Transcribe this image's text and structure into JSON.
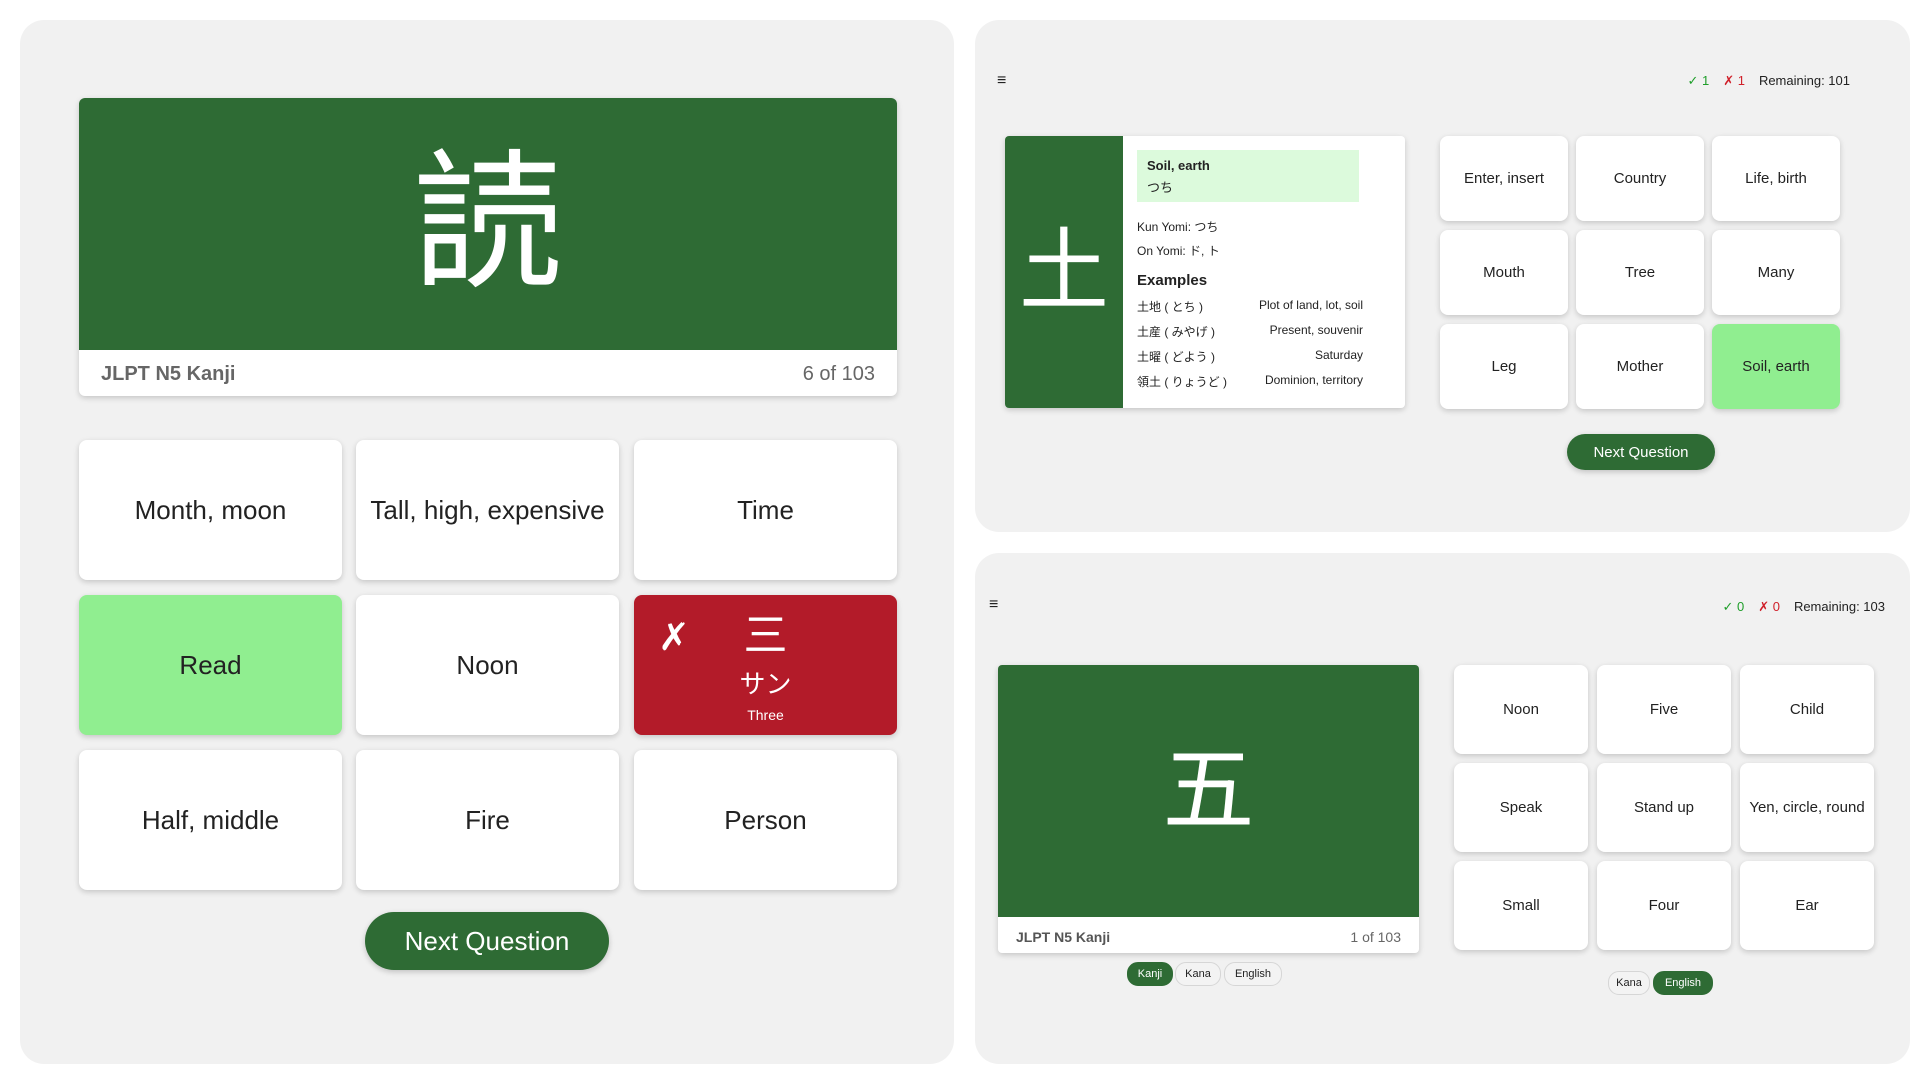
{
  "left": {
    "kanji": "読",
    "deck_title": "JLPT N5 Kanji",
    "progress": "6 of 103",
    "options": [
      "Month, moon",
      "Tall, high, expensive",
      "Time",
      "Read",
      "Noon",
      "",
      "Half, middle",
      "Fire",
      "Person"
    ],
    "wrong_option": {
      "mark": "✗",
      "kanji": "三",
      "kana": "サン",
      "meaning": "Three"
    },
    "next_label": "Next Question"
  },
  "top_right": {
    "menu_icon": "≡",
    "correct": "✓ 1",
    "wrong": "✗ 1",
    "remaining": "Remaining: 101",
    "kanji": "土",
    "meaning": "Soil, earth",
    "reading": "つち",
    "kun_yomi": "Kun Yomi: つち",
    "on_yomi": "On Yomi: ド, ト",
    "examples_title": "Examples",
    "examples": [
      {
        "word": "土地 ( とち )",
        "meaning": "Plot of land, lot, soil"
      },
      {
        "word": "土産 ( みやげ )",
        "meaning": "Present, souvenir"
      },
      {
        "word": "土曜 ( どよう )",
        "meaning": "Saturday"
      },
      {
        "word": "領土 ( りょうど )",
        "meaning": "Dominion, territory"
      }
    ],
    "options": [
      "Enter, insert",
      "Country",
      "Life, birth",
      "Mouth",
      "Tree",
      "Many",
      "Leg",
      "Mother",
      "Soil, earth"
    ],
    "next_label": "Next Question"
  },
  "bottom_right": {
    "menu_icon": "≡",
    "correct": "✓ 0",
    "wrong": "✗ 0",
    "remaining": "Remaining: 103",
    "kanji": "五",
    "deck_title": "JLPT N5 Kanji",
    "progress": "1 of 103",
    "question_modes": [
      "Kanji",
      "Kana",
      "English"
    ],
    "options": [
      "Noon",
      "Five",
      "Child",
      "Speak",
      "Stand up",
      "Yen, circle, round",
      "Small",
      "Four",
      "Ear"
    ],
    "answer_modes": [
      "Kana",
      "English"
    ]
  },
  "colors": {
    "green": "#2e6b34",
    "correct": "#90ee90",
    "wrong": "#b31b29",
    "panel": "#f1f1f1"
  }
}
